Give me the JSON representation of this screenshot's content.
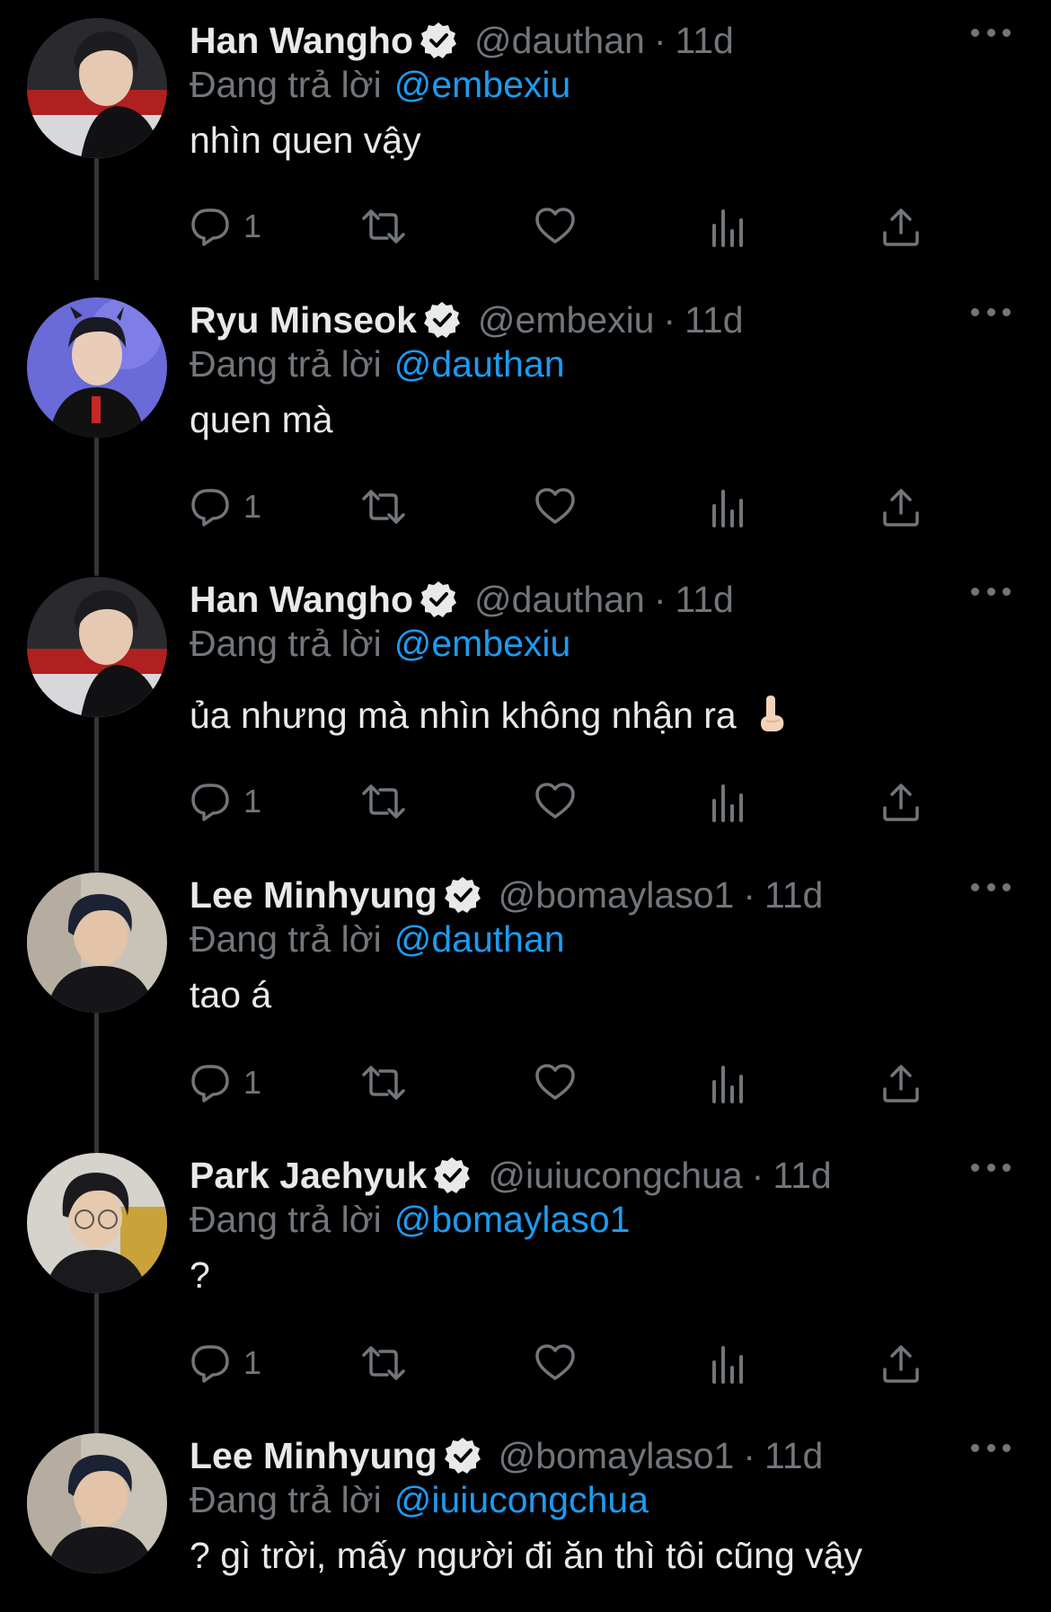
{
  "tweets": [
    {
      "display_name": "Han Wangho",
      "handle": "@dauthan",
      "separator": "·",
      "time": "11d",
      "reply_prefix": "Đang trả lời",
      "reply_to": "@embexiu",
      "text": "nhìn quen vậy",
      "emoji": "",
      "reply_count": "1",
      "avatar": "han-wangho"
    },
    {
      "display_name": "Ryu Minseok",
      "handle": "@embexiu",
      "separator": "·",
      "time": "11d",
      "reply_prefix": "Đang trả lời",
      "reply_to": "@dauthan",
      "text": "quen mà",
      "emoji": "",
      "reply_count": "1",
      "avatar": "ryu-minseok"
    },
    {
      "display_name": "Han Wangho",
      "handle": "@dauthan",
      "separator": "·",
      "time": "11d",
      "reply_prefix": "Đang trả lời",
      "reply_to": "@embexiu",
      "text": "ủa nhưng mà nhìn không nhận ra",
      "emoji": "pointing-hand-emoji",
      "reply_count": "1",
      "avatar": "han-wangho"
    },
    {
      "display_name": "Lee Minhyung",
      "handle": "@bomaylaso1",
      "separator": "·",
      "time": "11d",
      "reply_prefix": "Đang trả lời",
      "reply_to": "@dauthan",
      "text": "tao á",
      "emoji": "",
      "reply_count": "1",
      "avatar": "lee-minhyung"
    },
    {
      "display_name": "Park Jaehyuk",
      "handle": "@iuiucongchua",
      "separator": "·",
      "time": "11d",
      "reply_prefix": "Đang trả lời",
      "reply_to": "@bomaylaso1",
      "text": "?",
      "emoji": "",
      "reply_count": "1",
      "avatar": "park-jaehyuk"
    },
    {
      "display_name": "Lee Minhyung",
      "handle": "@bomaylaso1",
      "separator": "·",
      "time": "11d",
      "reply_prefix": "Đang trả lời",
      "reply_to": "@iuiucongchua",
      "text": "? gì trời, mấy người đi ăn thì tôi cũng vậy",
      "emoji": "",
      "reply_count": "",
      "avatar": "lee-minhyung"
    }
  ],
  "colors": {
    "background": "#000000",
    "text_primary": "#e7e9ea",
    "text_secondary": "#71767b",
    "link": "#1d9bf0",
    "thread_line": "#333639"
  },
  "icons": [
    "verified-badge-icon",
    "more-options-icon",
    "reply-icon",
    "retweet-icon",
    "like-icon",
    "views-icon",
    "share-icon"
  ]
}
